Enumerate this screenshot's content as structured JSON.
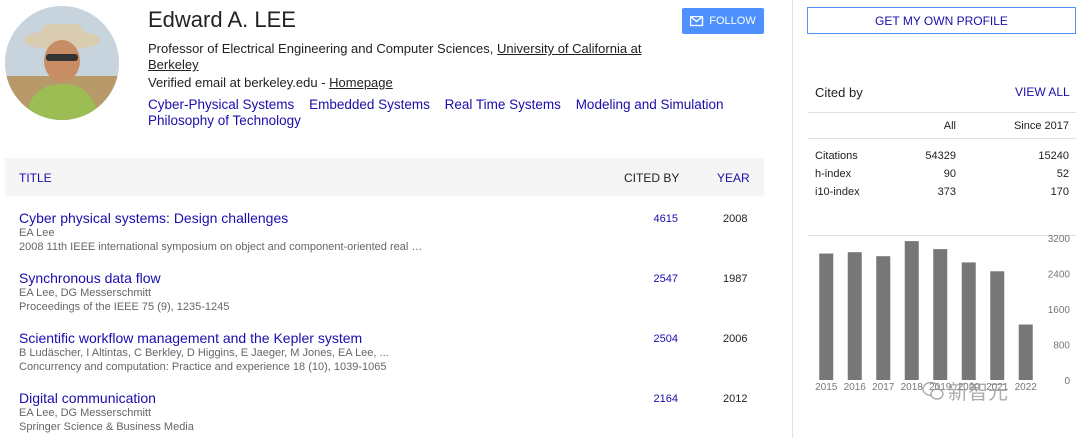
{
  "profile": {
    "name": "Edward A. LEE",
    "affiliation_prefix": "Professor of Electrical Engineering and Computer Sciences, ",
    "affiliation_link": "University of California at Berkeley",
    "email_text": "Verified email at berkeley.edu - ",
    "homepage": "Homepage",
    "follow_label": "FOLLOW",
    "interests": [
      "Cyber-Physical Systems",
      "Embedded Systems",
      "Real Time Systems",
      "Modeling and Simulation",
      "Philosophy of Technology"
    ]
  },
  "table": {
    "col_title": "TITLE",
    "col_cited": "CITED BY",
    "col_year": "YEAR",
    "rows": [
      {
        "title": "Cyber physical systems: Design challenges",
        "authors": "EA Lee",
        "venue": "2008 11th IEEE international symposium on object and component-oriented real …",
        "cited": "4615",
        "year": "2008"
      },
      {
        "title": "Synchronous data flow",
        "authors": "EA Lee, DG Messerschmitt",
        "venue": "Proceedings of the IEEE 75 (9), 1235-1245",
        "cited": "2547",
        "year": "1987"
      },
      {
        "title": "Scientific workflow management and the Kepler system",
        "authors": "B Ludäscher, I Altintas, C Berkley, D Higgins, E Jaeger, M Jones, EA Lee, ...",
        "venue": "Concurrency and computation: Practice and experience 18 (10), 1039-1065",
        "cited": "2504",
        "year": "2006"
      },
      {
        "title": "Digital communication",
        "authors": "EA Lee, DG Messerschmitt",
        "venue": "Springer Science & Business Media",
        "cited": "2164",
        "year": "2012"
      }
    ]
  },
  "sidebar": {
    "get_profile": "GET MY OWN PROFILE",
    "cited_by": "Cited by",
    "view_all": "VIEW ALL",
    "col_all": "All",
    "col_since": "Since 2017",
    "stats": [
      {
        "label": "Citations",
        "all": "54329",
        "since": "15240"
      },
      {
        "label": "h-index",
        "all": "90",
        "since": "52"
      },
      {
        "label": "i10-index",
        "all": "373",
        "since": "170"
      }
    ]
  },
  "watermark": "新智元",
  "chart_data": {
    "type": "bar",
    "categories": [
      "2015",
      "2016",
      "2017",
      "2018",
      "2019",
      "2020",
      "2021",
      "2022"
    ],
    "values": [
      2850,
      2880,
      2790,
      3130,
      2950,
      2650,
      2450,
      1250
    ],
    "ylim": [
      0,
      3200
    ],
    "yticks": [
      "0",
      "800",
      "1600",
      "2400",
      "3200"
    ],
    "color": "#777777",
    "grid": false
  }
}
